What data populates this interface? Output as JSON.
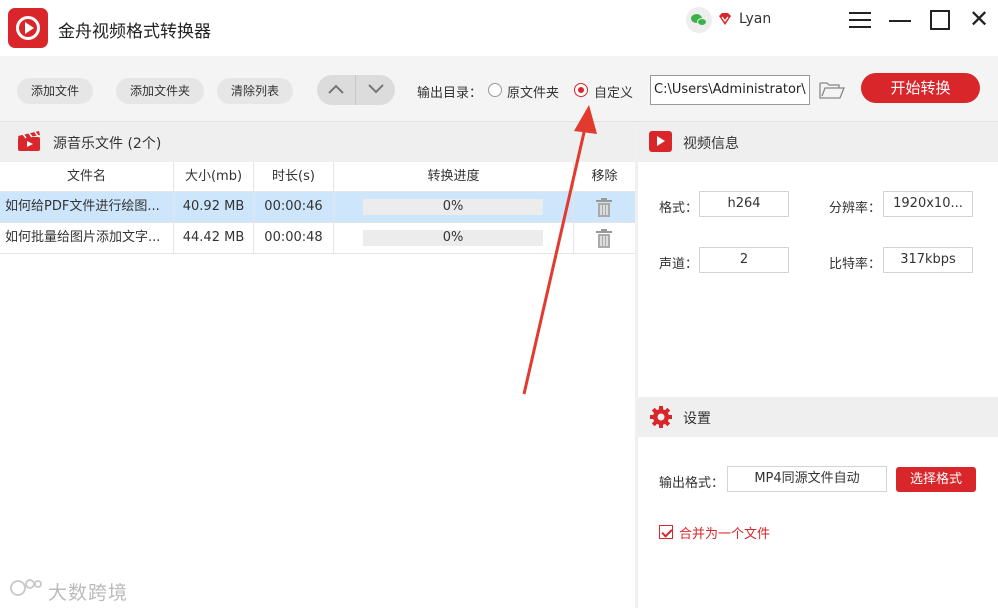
{
  "window": {
    "app_title": "金舟视频格式转换器",
    "user_name": "Lyan",
    "icons": [
      "app-logo",
      "wechat-icon",
      "vip-icon",
      "menu-icon",
      "minimize-icon",
      "maximize-icon",
      "close-icon"
    ]
  },
  "toolbar": {
    "add_file": "添加文件",
    "add_folder": "添加文件夹",
    "clear_list": "清除列表",
    "output_dir_label": "输出目录：",
    "radio_original": "原文件夹",
    "radio_custom": "自定义",
    "selected_output": "自定义",
    "path_value": "C:\\Users\\Administrator\\",
    "start_button": "开始转换"
  },
  "file_list": {
    "title": "源音乐文件 (2个)",
    "columns": [
      "文件名",
      "大小(mb)",
      "时长(s)",
      "转换进度",
      "移除"
    ],
    "rows": [
      {
        "name": "如何给PDF文件进行绘图...",
        "size": "40.92 MB",
        "duration": "00:00:46",
        "progress_text": "0%",
        "progress": 0,
        "selected": true
      },
      {
        "name": "如何批量给图片添加文字...",
        "size": "44.42 MB",
        "duration": "00:00:48",
        "progress_text": "0%",
        "progress": 0,
        "selected": false
      }
    ]
  },
  "video_info": {
    "title": "视频信息",
    "format_label": "格式：",
    "format_value": "h264",
    "resolution_label": "分辨率：",
    "resolution_value": "1920x10...",
    "channel_label": "声道：",
    "channel_value": "2",
    "bitrate_label": "比特率：",
    "bitrate_value": "317kbps"
  },
  "settings": {
    "title": "设置",
    "output_format_label": "输出格式：",
    "output_format_value": "MP4同源文件自动",
    "choose_format_button": "选择格式",
    "merge_label": "合并为一个文件",
    "merge_checked": true
  },
  "watermark": {
    "text": "大数跨境"
  },
  "colors": {
    "accent": "#d8262a",
    "selected_row": "#cde6fb",
    "panel_header": "#efefef"
  }
}
